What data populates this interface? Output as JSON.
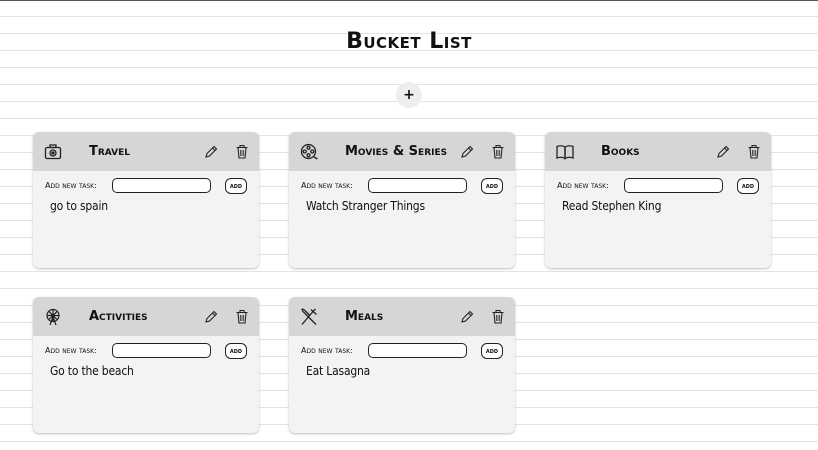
{
  "app": {
    "title": "Bucket List",
    "add_list_label": "+"
  },
  "cards": [
    {
      "icon": "camera-icon",
      "title": "Travel",
      "task_label": "Add new task:",
      "add_label": "add",
      "input_value": "",
      "tasks": [
        "go to spain"
      ]
    },
    {
      "icon": "film-reel-icon",
      "title": "Movies & Series",
      "task_label": "Add new task:",
      "add_label": "add",
      "input_value": "",
      "tasks": [
        "Watch Stranger Things"
      ]
    },
    {
      "icon": "open-book-icon",
      "title": "Books",
      "task_label": "Add new task:",
      "add_label": "add",
      "input_value": "",
      "tasks": [
        "Read Stephen King"
      ]
    },
    {
      "icon": "ferris-wheel-icon",
      "title": "Activities",
      "task_label": "Add new task:",
      "add_label": "add",
      "input_value": "",
      "tasks": [
        "Go to the beach"
      ]
    },
    {
      "icon": "fork-knife-icon",
      "title": "Meals",
      "task_label": "Add new task:",
      "add_label": "add",
      "input_value": "",
      "tasks": [
        "Eat Lasagna"
      ]
    }
  ]
}
